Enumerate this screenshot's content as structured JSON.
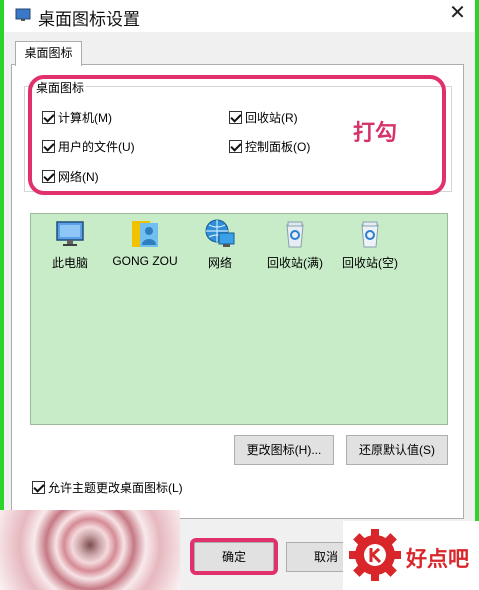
{
  "window": {
    "title": "桌面图标设置",
    "close_glyph": "✕"
  },
  "tab": {
    "label": "桌面图标"
  },
  "group": {
    "label": "桌面图标",
    "checkboxes": [
      {
        "label": "计算机(M)",
        "checked": true
      },
      {
        "label": "回收站(R)",
        "checked": true
      },
      {
        "label": "用户的文件(U)",
        "checked": true
      },
      {
        "label": "控制面板(O)",
        "checked": true
      },
      {
        "label": "网络(N)",
        "checked": true
      }
    ]
  },
  "annotation": {
    "text": "打勾",
    "color": "#d6336c"
  },
  "icons": [
    {
      "label": "此电脑",
      "icon": "computer-icon"
    },
    {
      "label": "GONG ZOU",
      "icon": "user-folder-icon"
    },
    {
      "label": "网络",
      "icon": "network-icon"
    },
    {
      "label": "回收站(满)",
      "icon": "recycle-bin-full-icon"
    },
    {
      "label": "回收站(空)",
      "icon": "recycle-bin-empty-icon"
    }
  ],
  "buttons": {
    "change_icon": "更改图标(H)...",
    "restore_default": "还原默认值(S)",
    "ok": "确定",
    "cancel": "取消"
  },
  "allow_theme": {
    "label": "允许主题更改桌面图标(L)",
    "checked": true
  },
  "watermark": {
    "text": "好点吧",
    "color": "#d9262a"
  },
  "colors": {
    "highlight": "#e0306e",
    "list_bg": "#c8ecc8",
    "frame": "#2bd42b"
  }
}
